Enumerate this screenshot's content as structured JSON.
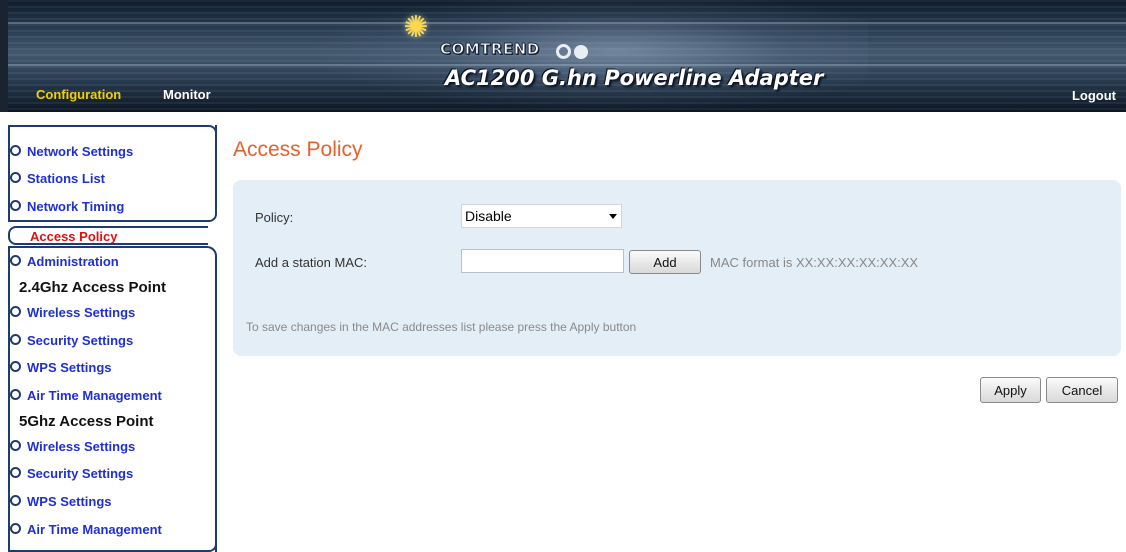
{
  "header": {
    "logo_text": "COMTREND",
    "product_title": "AC1200 G.hn Powerline Adapter",
    "nav": {
      "configuration": "Configuration",
      "monitor": "Monitor"
    },
    "logout": "Logout",
    "colors": {
      "nav_active": "#f2d000",
      "banner": "#2b3f55"
    }
  },
  "sidebar": {
    "network_group": [
      "Network Settings",
      "Stations List",
      "Network Timing"
    ],
    "active_item": "Access Policy",
    "administration": "Administration",
    "ap24": {
      "heading": "2.4Ghz Access Point",
      "items": [
        "Wireless Settings",
        "Security Settings",
        "WPS Settings",
        "Air Time Management"
      ]
    },
    "ap5": {
      "heading": "5Ghz Access Point",
      "items": [
        "Wireless Settings",
        "Security Settings",
        "WPS Settings",
        "Air Time Management"
      ]
    },
    "colors": {
      "link": "#1f2fd6",
      "active": "#e01010"
    }
  },
  "main": {
    "title": "Access Policy",
    "policy_label": "Policy:",
    "policy_value": "Disable",
    "mac_label": "Add a station MAC:",
    "mac_value": "",
    "add_button": "Add",
    "mac_hint": "MAC format is XX:XX:XX:XX:XX:XX",
    "save_note": "To save changes in the MAC addresses list please press the Apply button",
    "apply_button": "Apply",
    "cancel_button": "Cancel",
    "colors": {
      "title": "#e8602a",
      "panel": "#e4eef7"
    }
  }
}
